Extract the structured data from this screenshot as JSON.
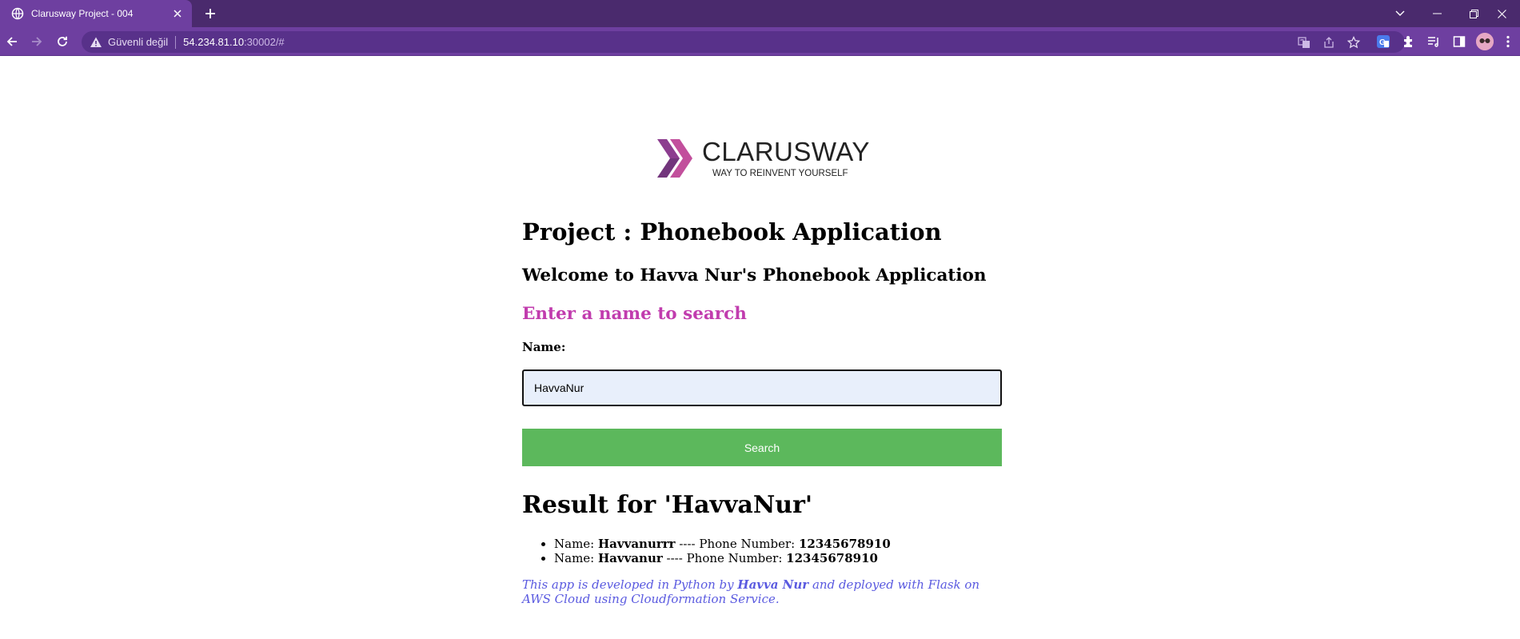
{
  "browser": {
    "tab_title": "Clarusway Project - 004",
    "security_text": "Güvenli değil",
    "url_host": "54.234.81.10",
    "url_rest": ":30002/#"
  },
  "logo": {
    "name": "CLARUSWAY",
    "tagline": "WAY TO REINVENT YOURSELF"
  },
  "page": {
    "title": "Project : Phonebook Application",
    "welcome": "Welcome to Havva Nur's Phonebook Application",
    "search_heading": "Enter a name to search",
    "name_label": "Name:",
    "name_value": "HavvaNur",
    "search_button": "Search",
    "result_heading": "Result for 'HavvaNur'",
    "results": [
      {
        "name_prefix": "Name: ",
        "name": "Havvanurrr",
        "sep": " ---- Phone Number: ",
        "phone": "12345678910"
      },
      {
        "name_prefix": "Name: ",
        "name": "Havvanur",
        "sep": " ---- Phone Number: ",
        "phone": "12345678910"
      }
    ],
    "footer": {
      "part1": "This app is developed in Python by ",
      "author": "Havva Nur",
      "part2": " and deployed with Flask on AWS Cloud using Cloudformation Service."
    }
  },
  "colors": {
    "tabstrip": "#4a2a6d",
    "toolbar": "#6e3fa0",
    "search_heading": "#c13cae",
    "search_button": "#5cb85c",
    "footer_text": "#5a5ae0"
  },
  "icons": [
    "globe-icon",
    "close-icon",
    "plus-icon",
    "back-icon",
    "forward-icon",
    "reload-icon",
    "warning-icon",
    "translate-icon",
    "share-icon",
    "star-icon",
    "google-translate-icon",
    "extensions-icon",
    "reading-list-icon",
    "side-panel-icon",
    "profile-avatar-icon",
    "kebab-menu-icon",
    "minimize-icon",
    "restore-icon",
    "window-close-icon",
    "tab-search-icon"
  ]
}
